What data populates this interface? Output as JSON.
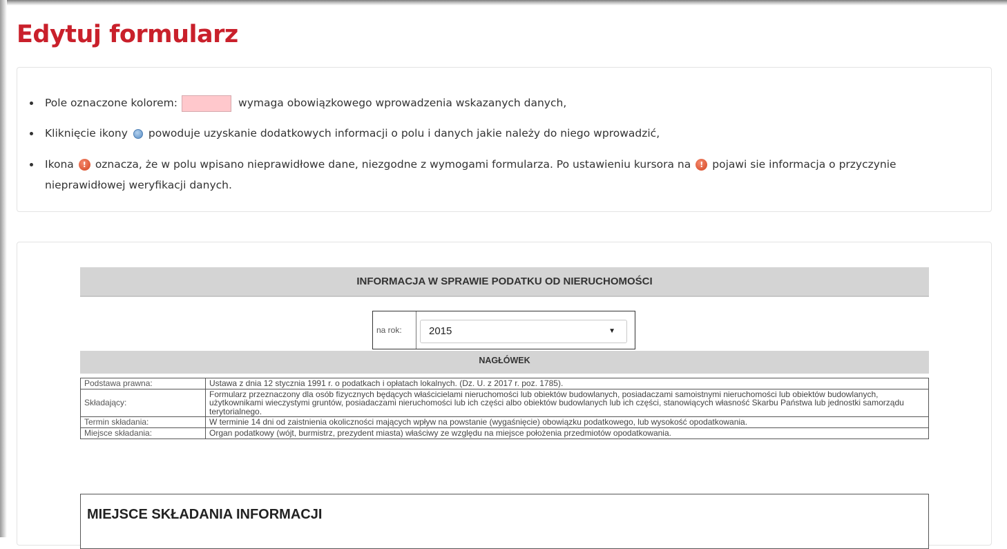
{
  "page": {
    "title": "Edytuj formularz"
  },
  "info": {
    "items": [
      {
        "before": "Pole oznaczone kolorem:",
        "after": "wymaga obowiązkowego wprowadzenia wskazanych danych,",
        "icon": "required-color-swatch"
      },
      {
        "before": "Kliknięcie ikony",
        "after": "powoduje uzyskanie dodatkowych informacji o polu i danych jakie należy do niego wprowadzić,",
        "icon": "info-icon"
      },
      {
        "before": "Ikona",
        "middle": "oznacza, że w polu wpisano nieprawidłowe dane, niezgodne z wymogami formularza. Po ustawieniu kursora na",
        "after": "pojawi sie informacja o przyczynie nieprawidłowej weryfikacji danych.",
        "icon": "error-icon"
      }
    ],
    "swatch_color": "#ffc8cc"
  },
  "form": {
    "banner": "INFORMACJA W SPRAWIE PODATKU OD NIERUCHOMOŚCI",
    "year_label": "na rok:",
    "year_value": "2015",
    "section": "NAGŁÓWEK",
    "rows": [
      {
        "label": "Podstawa prawna:",
        "value": "Ustawa z dnia 12 stycznia 1991 r. o podatkach i opłatach lokalnych. (Dz. U. z 2017 r. poz. 1785)."
      },
      {
        "label": "Składający:",
        "value": "Formularz przeznaczony dla osób fizycznych będących właścicielami nieruchomości lub obiektów budowlanych, posiadaczami samoistnymi nieruchomości lub obiektów budowlanych, użytkownikami wieczystymi gruntów, posiadaczami nieruchomości lub ich części albo obiektów budowlanych lub ich części, stanowiących własność Skarbu Państwa lub jednostki samorządu terytorialnego."
      },
      {
        "label": "Termin składania:",
        "value": "W terminie 14 dni od zaistnienia okoliczności mających wpływ na powstanie (wygaśnięcie) obowiązku podatkowego, lub wysokość opodatkowania."
      },
      {
        "label": "Miejsce składania:",
        "value": "Organ podatkowy (wójt, burmistrz, prezydent miasta) właściwy ze względu na miejsce położenia przedmiotów opodatkowania."
      }
    ],
    "place_title": "MIEJSCE SKŁADANIA INFORMACJI"
  }
}
